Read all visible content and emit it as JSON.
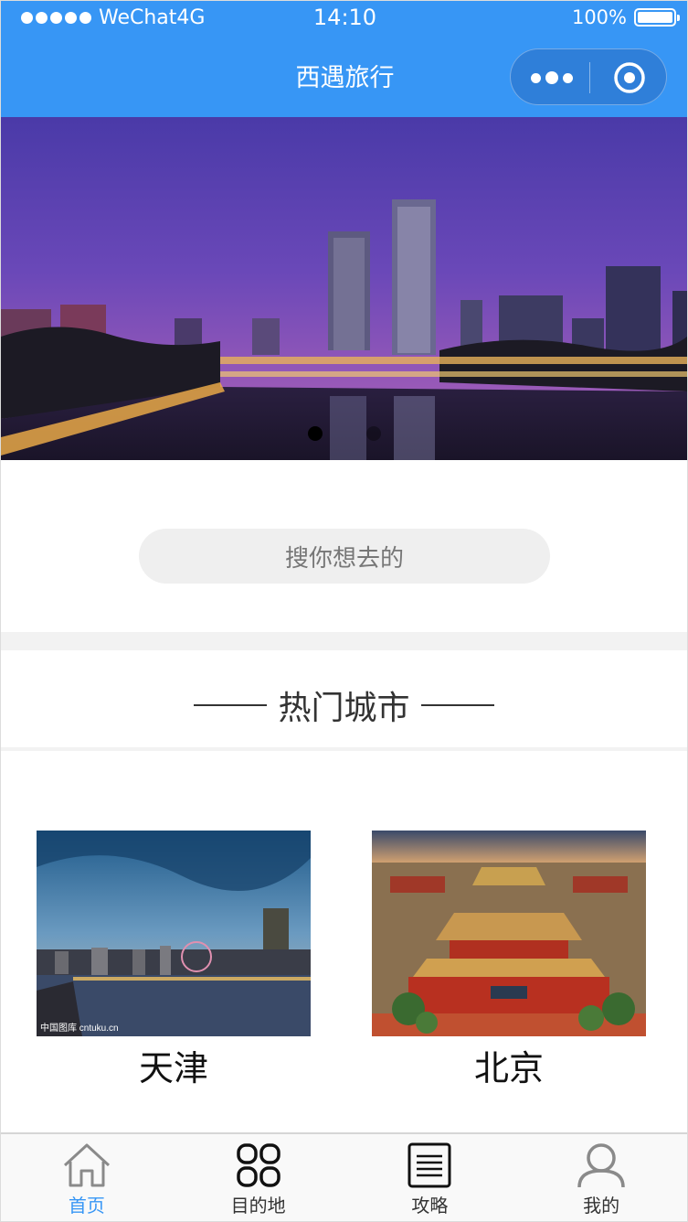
{
  "status_bar": {
    "carrier": "WeChat4G",
    "time": "14:10",
    "battery": "100%"
  },
  "nav": {
    "title": "西遇旅行"
  },
  "banner": {
    "page_count": 2,
    "active_index": 0
  },
  "search": {
    "placeholder": "搜你想去的"
  },
  "hot_cities": {
    "title": "热门城市",
    "items": [
      {
        "name": "天津",
        "watermark": "中国图库 cntuku.cn"
      },
      {
        "name": "北京"
      }
    ]
  },
  "tabbar": {
    "items": [
      {
        "label": "首页",
        "icon": "home-icon",
        "active": true
      },
      {
        "label": "目的地",
        "icon": "grid-icon",
        "active": false
      },
      {
        "label": "攻略",
        "icon": "document-icon",
        "active": false
      },
      {
        "label": "我的",
        "icon": "user-icon",
        "active": false
      }
    ]
  },
  "colors": {
    "primary": "#3796f5",
    "capsule": "#2f7fd9",
    "search_bg": "#efefef",
    "divider": "#f2f2f2"
  }
}
